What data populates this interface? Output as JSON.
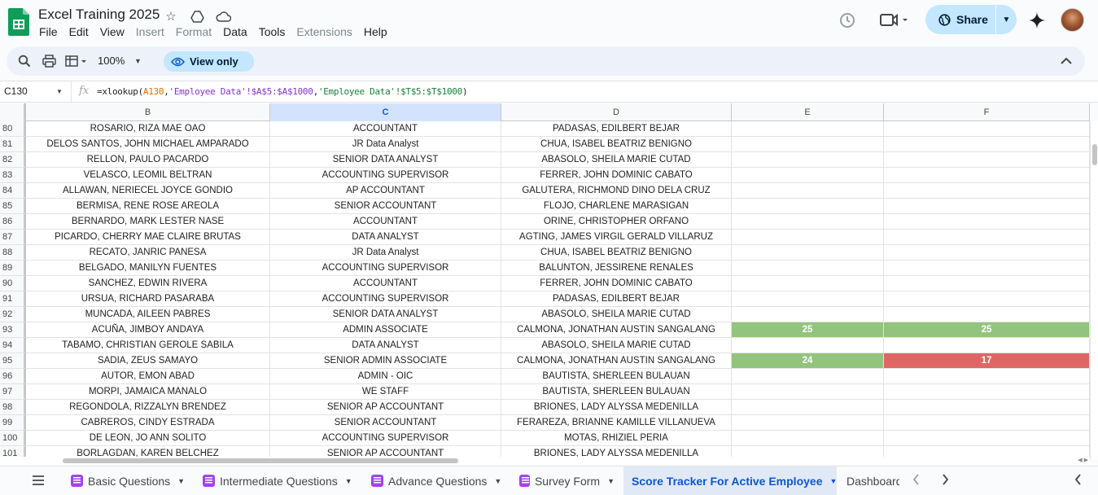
{
  "app": {
    "title": "Excel Training 2025",
    "menu": [
      {
        "label": "File",
        "enabled": true
      },
      {
        "label": "Edit",
        "enabled": true
      },
      {
        "label": "View",
        "enabled": true
      },
      {
        "label": "Insert",
        "enabled": false
      },
      {
        "label": "Format",
        "enabled": false
      },
      {
        "label": "Data",
        "enabled": true
      },
      {
        "label": "Tools",
        "enabled": true
      },
      {
        "label": "Extensions",
        "enabled": false
      },
      {
        "label": "Help",
        "enabled": true
      }
    ],
    "share_label": "Share"
  },
  "toolbar": {
    "zoom": "100%",
    "view_only_label": "View only"
  },
  "formula_bar": {
    "cell_ref": "C130",
    "fx": "fx",
    "formula_parts": [
      "=xlookup(",
      "A130",
      ",",
      "'Employee Data'!$A$5:$A$1000",
      ",",
      "'Employee Data'!$T$5:$T$1000",
      ")"
    ]
  },
  "grid": {
    "columns": [
      "B",
      "C",
      "D",
      "E",
      "F"
    ],
    "selected_column": "C",
    "rows": [
      {
        "n": "80",
        "b": "ROSARIO, RIZA MAE OAO",
        "c": "ACCOUNTANT",
        "d": "PADASAS, EDILBERT BEJAR",
        "e": "",
        "f": ""
      },
      {
        "n": "81",
        "b": "DELOS SANTOS, JOHN MICHAEL  AMPARADO",
        "c": "JR Data Analyst",
        "d": "CHUA, ISABEL BEATRIZ BENIGNO",
        "e": "",
        "f": ""
      },
      {
        "n": "82",
        "b": "RELLON, PAULO PACARDO",
        "c": "SENIOR DATA ANALYST",
        "d": "ABASOLO, SHEILA MARIE CUTAD",
        "e": "",
        "f": ""
      },
      {
        "n": "83",
        "b": "VELASCO, LEOMIL BELTRAN",
        "c": "ACCOUNTING SUPERVISOR",
        "d": "FERRER, JOHN DOMINIC CABATO",
        "e": "",
        "f": ""
      },
      {
        "n": "84",
        "b": "ALLAWAN, NERIECEL JOYCE GONDIO",
        "c": "AP ACCOUNTANT",
        "d": "GALUTERA, RICHMOND DINO DELA CRUZ",
        "e": "",
        "f": ""
      },
      {
        "n": "85",
        "b": "BERMISA, RENE ROSE AREOLA",
        "c": "SENIOR ACCOUNTANT",
        "d": "FLOJO, CHARLENE MARASIGAN",
        "e": "",
        "f": ""
      },
      {
        "n": "86",
        "b": "BERNARDO, MARK LESTER NASE",
        "c": "ACCOUNTANT",
        "d": "ORINE, CHRISTOPHER ORFANO",
        "e": "",
        "f": ""
      },
      {
        "n": "87",
        "b": "PICARDO, CHERRY MAE CLAIRE BRUTAS",
        "c": "DATA ANALYST",
        "d": "AGTING, JAMES VIRGIL GERALD VILLARUZ",
        "e": "",
        "f": ""
      },
      {
        "n": "88",
        "b": "RECATO, JANRIC PANESA",
        "c": "JR Data Analyst",
        "d": "CHUA, ISABEL BEATRIZ BENIGNO",
        "e": "",
        "f": ""
      },
      {
        "n": "89",
        "b": "BELGADO, MANILYN FUENTES",
        "c": "ACCOUNTING SUPERVISOR",
        "d": "BALUNTON, JESSIRENE RENALES",
        "e": "",
        "f": ""
      },
      {
        "n": "90",
        "b": "SANCHEZ, EDWIN RIVERA",
        "c": "ACCOUNTANT",
        "d": "FERRER, JOHN DOMINIC CABATO",
        "e": "",
        "f": ""
      },
      {
        "n": "91",
        "b": "URSUA, RICHARD PASARABA",
        "c": "ACCOUNTING SUPERVISOR",
        "d": "PADASAS, EDILBERT BEJAR",
        "e": "",
        "f": ""
      },
      {
        "n": "92",
        "b": "MUNCADA, AILEEN PABRES",
        "c": "SENIOR DATA ANALYST",
        "d": "ABASOLO, SHEILA MARIE CUTAD",
        "e": "",
        "f": ""
      },
      {
        "n": "93",
        "b": "ACUÑA, JIMBOY ANDAYA",
        "c": "ADMIN ASSOCIATE",
        "d": "CALMONA, JONATHAN AUSTIN SANGALANG",
        "e": "25",
        "f": "25",
        "e_color": "green",
        "f_color": "green"
      },
      {
        "n": "94",
        "b": "TABAMO, CHRISTIAN GEROLE SABILA",
        "c": "DATA ANALYST",
        "d": "ABASOLO, SHEILA MARIE CUTAD",
        "e": "",
        "f": ""
      },
      {
        "n": "95",
        "b": "SADIA, ZEUS SAMAYO",
        "c": "SENIOR ADMIN ASSOCIATE",
        "d": "CALMONA, JONATHAN AUSTIN SANGALANG",
        "e": "24",
        "f": "17",
        "e_color": "green",
        "f_color": "red"
      },
      {
        "n": "96",
        "b": "AUTOR, EMON ABAD",
        "c": "ADMIN - OIC",
        "d": "BAUTISTA, SHERLEEN BULAUAN",
        "e": "",
        "f": ""
      },
      {
        "n": "97",
        "b": "MORPI, JAMAICA MANALO",
        "c": "WE STAFF",
        "d": "BAUTISTA, SHERLEEN BULAUAN",
        "e": "",
        "f": ""
      },
      {
        "n": "98",
        "b": "REGONDOLA, RIZZALYN BRENDEZ",
        "c": "SENIOR AP ACCOUNTANT",
        "d": "BRIONES, LADY ALYSSA MEDENILLA",
        "e": "",
        "f": ""
      },
      {
        "n": "99",
        "b": "CABREROS, CINDY ESTRADA",
        "c": "SENIOR ACCOUNTANT",
        "d": "FERAREZA, BRIANNE KAMILLE VILLANUEVA",
        "e": "",
        "f": ""
      },
      {
        "n": "100",
        "b": "DE LEON, JO ANN SOLITO",
        "c": "ACCOUNTING SUPERVISOR",
        "d": "MOTAS, RHIZIEL PERIA",
        "e": "",
        "f": ""
      },
      {
        "n": "101",
        "b": "BORLAGDAN, KAREN BELCHEZ",
        "c": "SENIOR AP ACCOUNTANT",
        "d": "BRIONES, LADY ALYSSA MEDENILLA",
        "e": "",
        "f": ""
      }
    ]
  },
  "sheets": {
    "tabs": [
      {
        "label": "Basic Questions",
        "icon": "form-icon",
        "active": false
      },
      {
        "label": "Intermediate Questions",
        "icon": "form-icon",
        "active": false
      },
      {
        "label": "Advance Questions",
        "icon": "form-icon",
        "active": false
      },
      {
        "label": "Survey Form",
        "icon": "form-icon",
        "active": false
      },
      {
        "label": "Score Tracker For Active Employee",
        "icon": "",
        "active": true
      },
      {
        "label": "Dashboard",
        "icon": "",
        "active": false
      }
    ]
  },
  "colors": {
    "accent": "#0b57d0",
    "share_bg": "#c2e7ff",
    "good": "#93c47d",
    "bad": "#e06666",
    "sheets_green": "#0f9d58"
  }
}
